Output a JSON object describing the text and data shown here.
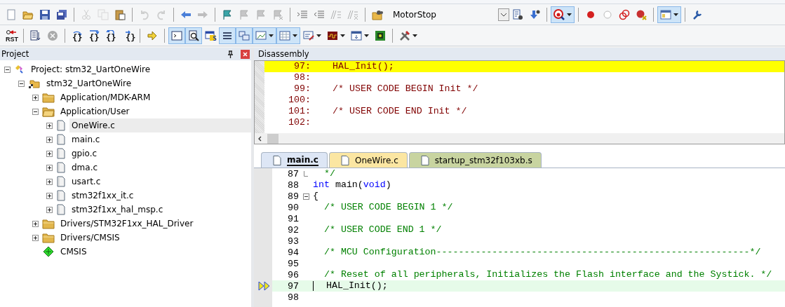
{
  "toolbars": [
    {
      "groups": [
        [
          {
            "kind": "new",
            "disabled": false,
            "pressed": false,
            "menu": false
          },
          {
            "kind": "open",
            "disabled": false,
            "pressed": false,
            "menu": false
          },
          {
            "kind": "save",
            "disabled": false,
            "pressed": false,
            "menu": false
          },
          {
            "kind": "saveall",
            "disabled": false,
            "pressed": false,
            "menu": false
          }
        ],
        [
          {
            "kind": "cut",
            "disabled": true,
            "pressed": false,
            "menu": false
          },
          {
            "kind": "copy",
            "disabled": true,
            "pressed": false,
            "menu": false
          },
          {
            "kind": "paste",
            "disabled": false,
            "pressed": false,
            "menu": false
          }
        ],
        [
          {
            "kind": "undo",
            "disabled": true,
            "pressed": false,
            "menu": false
          },
          {
            "kind": "redo",
            "disabled": true,
            "pressed": false,
            "menu": false
          }
        ],
        [
          {
            "kind": "back",
            "disabled": false,
            "pressed": false,
            "menu": false
          },
          {
            "kind": "forward",
            "disabled": true,
            "pressed": false,
            "menu": false
          }
        ],
        [
          {
            "kind": "flag",
            "disabled": false,
            "pressed": false,
            "menu": false
          },
          {
            "kind": "flagprev",
            "disabled": true,
            "pressed": false,
            "menu": false
          },
          {
            "kind": "flagnext",
            "disabled": true,
            "pressed": false,
            "menu": false
          },
          {
            "kind": "flagclear",
            "disabled": true,
            "pressed": false,
            "menu": false
          }
        ],
        [
          {
            "kind": "indent",
            "disabled": false,
            "pressed": false,
            "menu": false
          },
          {
            "kind": "unindent",
            "disabled": false,
            "pressed": false,
            "menu": false
          },
          {
            "kind": "comment",
            "disabled": true,
            "pressed": false,
            "menu": false
          },
          {
            "kind": "uncomment",
            "disabled": true,
            "pressed": false,
            "menu": false
          }
        ],
        [
          {
            "kind": "findfiles",
            "disabled": false,
            "pressed": false,
            "menu": false
          },
          {
            "kind": "combo",
            "value": "MotorStop"
          },
          {
            "kind": "filesearch",
            "disabled": false,
            "pressed": false,
            "menu": false
          },
          {
            "kind": "wizard",
            "disabled": false,
            "pressed": false,
            "menu": false
          }
        ],
        [
          {
            "kind": "debug",
            "disabled": false,
            "pressed": true,
            "menu": true
          }
        ],
        [
          {
            "kind": "bp",
            "disabled": false,
            "pressed": false,
            "menu": false
          },
          {
            "kind": "bpoff",
            "disabled": false,
            "pressed": false,
            "menu": false
          },
          {
            "kind": "bpall",
            "disabled": false,
            "pressed": false,
            "menu": false
          },
          {
            "kind": "bpkill",
            "disabled": false,
            "pressed": false,
            "menu": false
          }
        ],
        [
          {
            "kind": "layout",
            "disabled": false,
            "pressed": true,
            "menu": true
          }
        ],
        [
          {
            "kind": "wrench",
            "disabled": false,
            "pressed": false,
            "menu": false
          }
        ]
      ]
    },
    {
      "groups": [
        [
          {
            "kind": "reset",
            "label": "RST",
            "disabled": false,
            "pressed": false,
            "menu": false
          }
        ],
        [
          {
            "kind": "runlist",
            "disabled": false,
            "pressed": false,
            "menu": false
          },
          {
            "kind": "stop",
            "disabled": true,
            "pressed": false,
            "menu": false
          }
        ],
        [
          {
            "kind": "stepin",
            "label": "{}",
            "disabled": false,
            "pressed": false,
            "menu": false
          },
          {
            "kind": "stepover",
            "label": "{}",
            "disabled": false,
            "pressed": false,
            "menu": false
          },
          {
            "kind": "stepout",
            "label": "{}",
            "disabled": false,
            "pressed": false,
            "menu": false
          },
          {
            "kind": "runcursor",
            "label": "{}",
            "disabled": false,
            "pressed": false,
            "menu": false
          }
        ],
        [
          {
            "kind": "nextstmt",
            "disabled": false,
            "pressed": false,
            "menu": false
          }
        ],
        [
          {
            "kind": "cmdwin",
            "disabled": false,
            "pressed": true,
            "menu": false
          },
          {
            "kind": "disasm",
            "disabled": false,
            "pressed": true,
            "menu": false
          },
          {
            "kind": "symbols",
            "label": "S",
            "disabled": false,
            "pressed": false,
            "menu": false
          },
          {
            "kind": "registers",
            "disabled": false,
            "pressed": true,
            "menu": false
          },
          {
            "kind": "callstack",
            "disabled": false,
            "pressed": true,
            "menu": false
          },
          {
            "kind": "watch",
            "disabled": false,
            "pressed": true,
            "menu": true
          },
          {
            "kind": "memory",
            "disabled": false,
            "pressed": true,
            "menu": true
          },
          {
            "kind": "serial",
            "disabled": false,
            "pressed": false,
            "menu": true
          },
          {
            "kind": "analyzer",
            "disabled": false,
            "pressed": false,
            "menu": true
          },
          {
            "kind": "sysview",
            "disabled": false,
            "pressed": false,
            "menu": true
          },
          {
            "kind": "toolbox",
            "disabled": false,
            "pressed": false,
            "menu": false
          }
        ],
        [
          {
            "kind": "tools",
            "disabled": false,
            "pressed": false,
            "menu": true
          }
        ]
      ]
    }
  ],
  "project_panel": {
    "title": "Project",
    "tree": [
      {
        "label": "Project: stm32_UartOneWire",
        "kind": "project",
        "expanded": true,
        "selected": false,
        "children": [
          {
            "label": "stm32_UartOneWire",
            "kind": "target",
            "expanded": true,
            "selected": false,
            "children": [
              {
                "label": "Application/MDK-ARM",
                "kind": "folder",
                "expanded": false,
                "selected": false
              },
              {
                "label": "Application/User",
                "kind": "folder",
                "expanded": true,
                "selected": false,
                "children": [
                  {
                    "label": "OneWire.c",
                    "kind": "file",
                    "expanded": false,
                    "selected": true
                  },
                  {
                    "label": "main.c",
                    "kind": "file",
                    "expanded": false,
                    "selected": false
                  },
                  {
                    "label": "gpio.c",
                    "kind": "file",
                    "expanded": false,
                    "selected": false
                  },
                  {
                    "label": "dma.c",
                    "kind": "file",
                    "expanded": false,
                    "selected": false
                  },
                  {
                    "label": "usart.c",
                    "kind": "file",
                    "expanded": false,
                    "selected": false
                  },
                  {
                    "label": "stm32f1xx_it.c",
                    "kind": "file",
                    "expanded": false,
                    "selected": false
                  },
                  {
                    "label": "stm32f1xx_hal_msp.c",
                    "kind": "file",
                    "expanded": false,
                    "selected": false
                  }
                ]
              },
              {
                "label": "Drivers/STM32F1xx_HAL_Driver",
                "kind": "folder",
                "expanded": false,
                "selected": false
              },
              {
                "label": "Drivers/CMSIS",
                "kind": "folder",
                "expanded": false,
                "selected": false
              },
              {
                "label": "CMSIS",
                "kind": "component",
                "selected": false
              }
            ]
          }
        ]
      }
    ]
  },
  "disassembly": {
    "title": "Disassembly",
    "lines": [
      {
        "num": "97:",
        "code": "HAL_Init();",
        "current": true
      },
      {
        "num": "98:",
        "current": false
      },
      {
        "num": "99:",
        "code": "/* USER CODE BEGIN Init */",
        "current": false
      },
      {
        "num": "100:",
        "current": false
      },
      {
        "num": "101:",
        "code": "/* USER CODE END Init */",
        "current": false
      },
      {
        "num": "102:",
        "current": false
      }
    ]
  },
  "editor": {
    "tabs": [
      {
        "label": "main.c",
        "selected": true,
        "color": "#dde6f5"
      },
      {
        "label": "OneWire.c",
        "selected": false,
        "color": "#fbe6a2"
      },
      {
        "label": "startup_stm32f103xb.s",
        "selected": false,
        "color": "#c8d4a0"
      }
    ],
    "lines": [
      {
        "num": "87",
        "kind": "foldend",
        "current": false,
        "parts": [
          {
            "text": "  */",
            "kind": "comment"
          }
        ]
      },
      {
        "num": "88",
        "kind": "code",
        "current": false,
        "parts": [
          {
            "text": "int",
            "kind": "keyword"
          },
          {
            "text": " main(",
            "kind": "plain"
          },
          {
            "text": "void",
            "kind": "keyword"
          },
          {
            "text": ")",
            "kind": "plain"
          }
        ]
      },
      {
        "num": "89",
        "kind": "foldstart",
        "current": false,
        "parts": [
          {
            "text": "{",
            "kind": "plain"
          }
        ]
      },
      {
        "num": "90",
        "kind": "code",
        "current": false,
        "parts": [
          {
            "text": "  /* USER CODE BEGIN 1 */",
            "kind": "comment"
          }
        ]
      },
      {
        "num": "91",
        "kind": "code",
        "current": false
      },
      {
        "num": "92",
        "kind": "code",
        "current": false,
        "parts": [
          {
            "text": "  /* USER CODE END 1 */",
            "kind": "comment"
          }
        ]
      },
      {
        "num": "93",
        "kind": "code",
        "current": false
      },
      {
        "num": "94",
        "kind": "code",
        "current": false,
        "parts": [
          {
            "text": "  /* MCU Configuration--------------------------------------------------------*/",
            "kind": "comment"
          }
        ]
      },
      {
        "num": "95",
        "kind": "code",
        "current": false
      },
      {
        "num": "96",
        "kind": "code",
        "current": false,
        "parts": [
          {
            "text": "  /* Reset of all peripherals, Initializes the Flash interface and the Systick. */",
            "kind": "comment"
          }
        ]
      },
      {
        "num": "97",
        "kind": "code",
        "current": true,
        "parts": [
          {
            "text": "  HAL_Init();",
            "kind": "plain"
          }
        ]
      },
      {
        "num": "98",
        "kind": "code",
        "current": false
      }
    ]
  }
}
